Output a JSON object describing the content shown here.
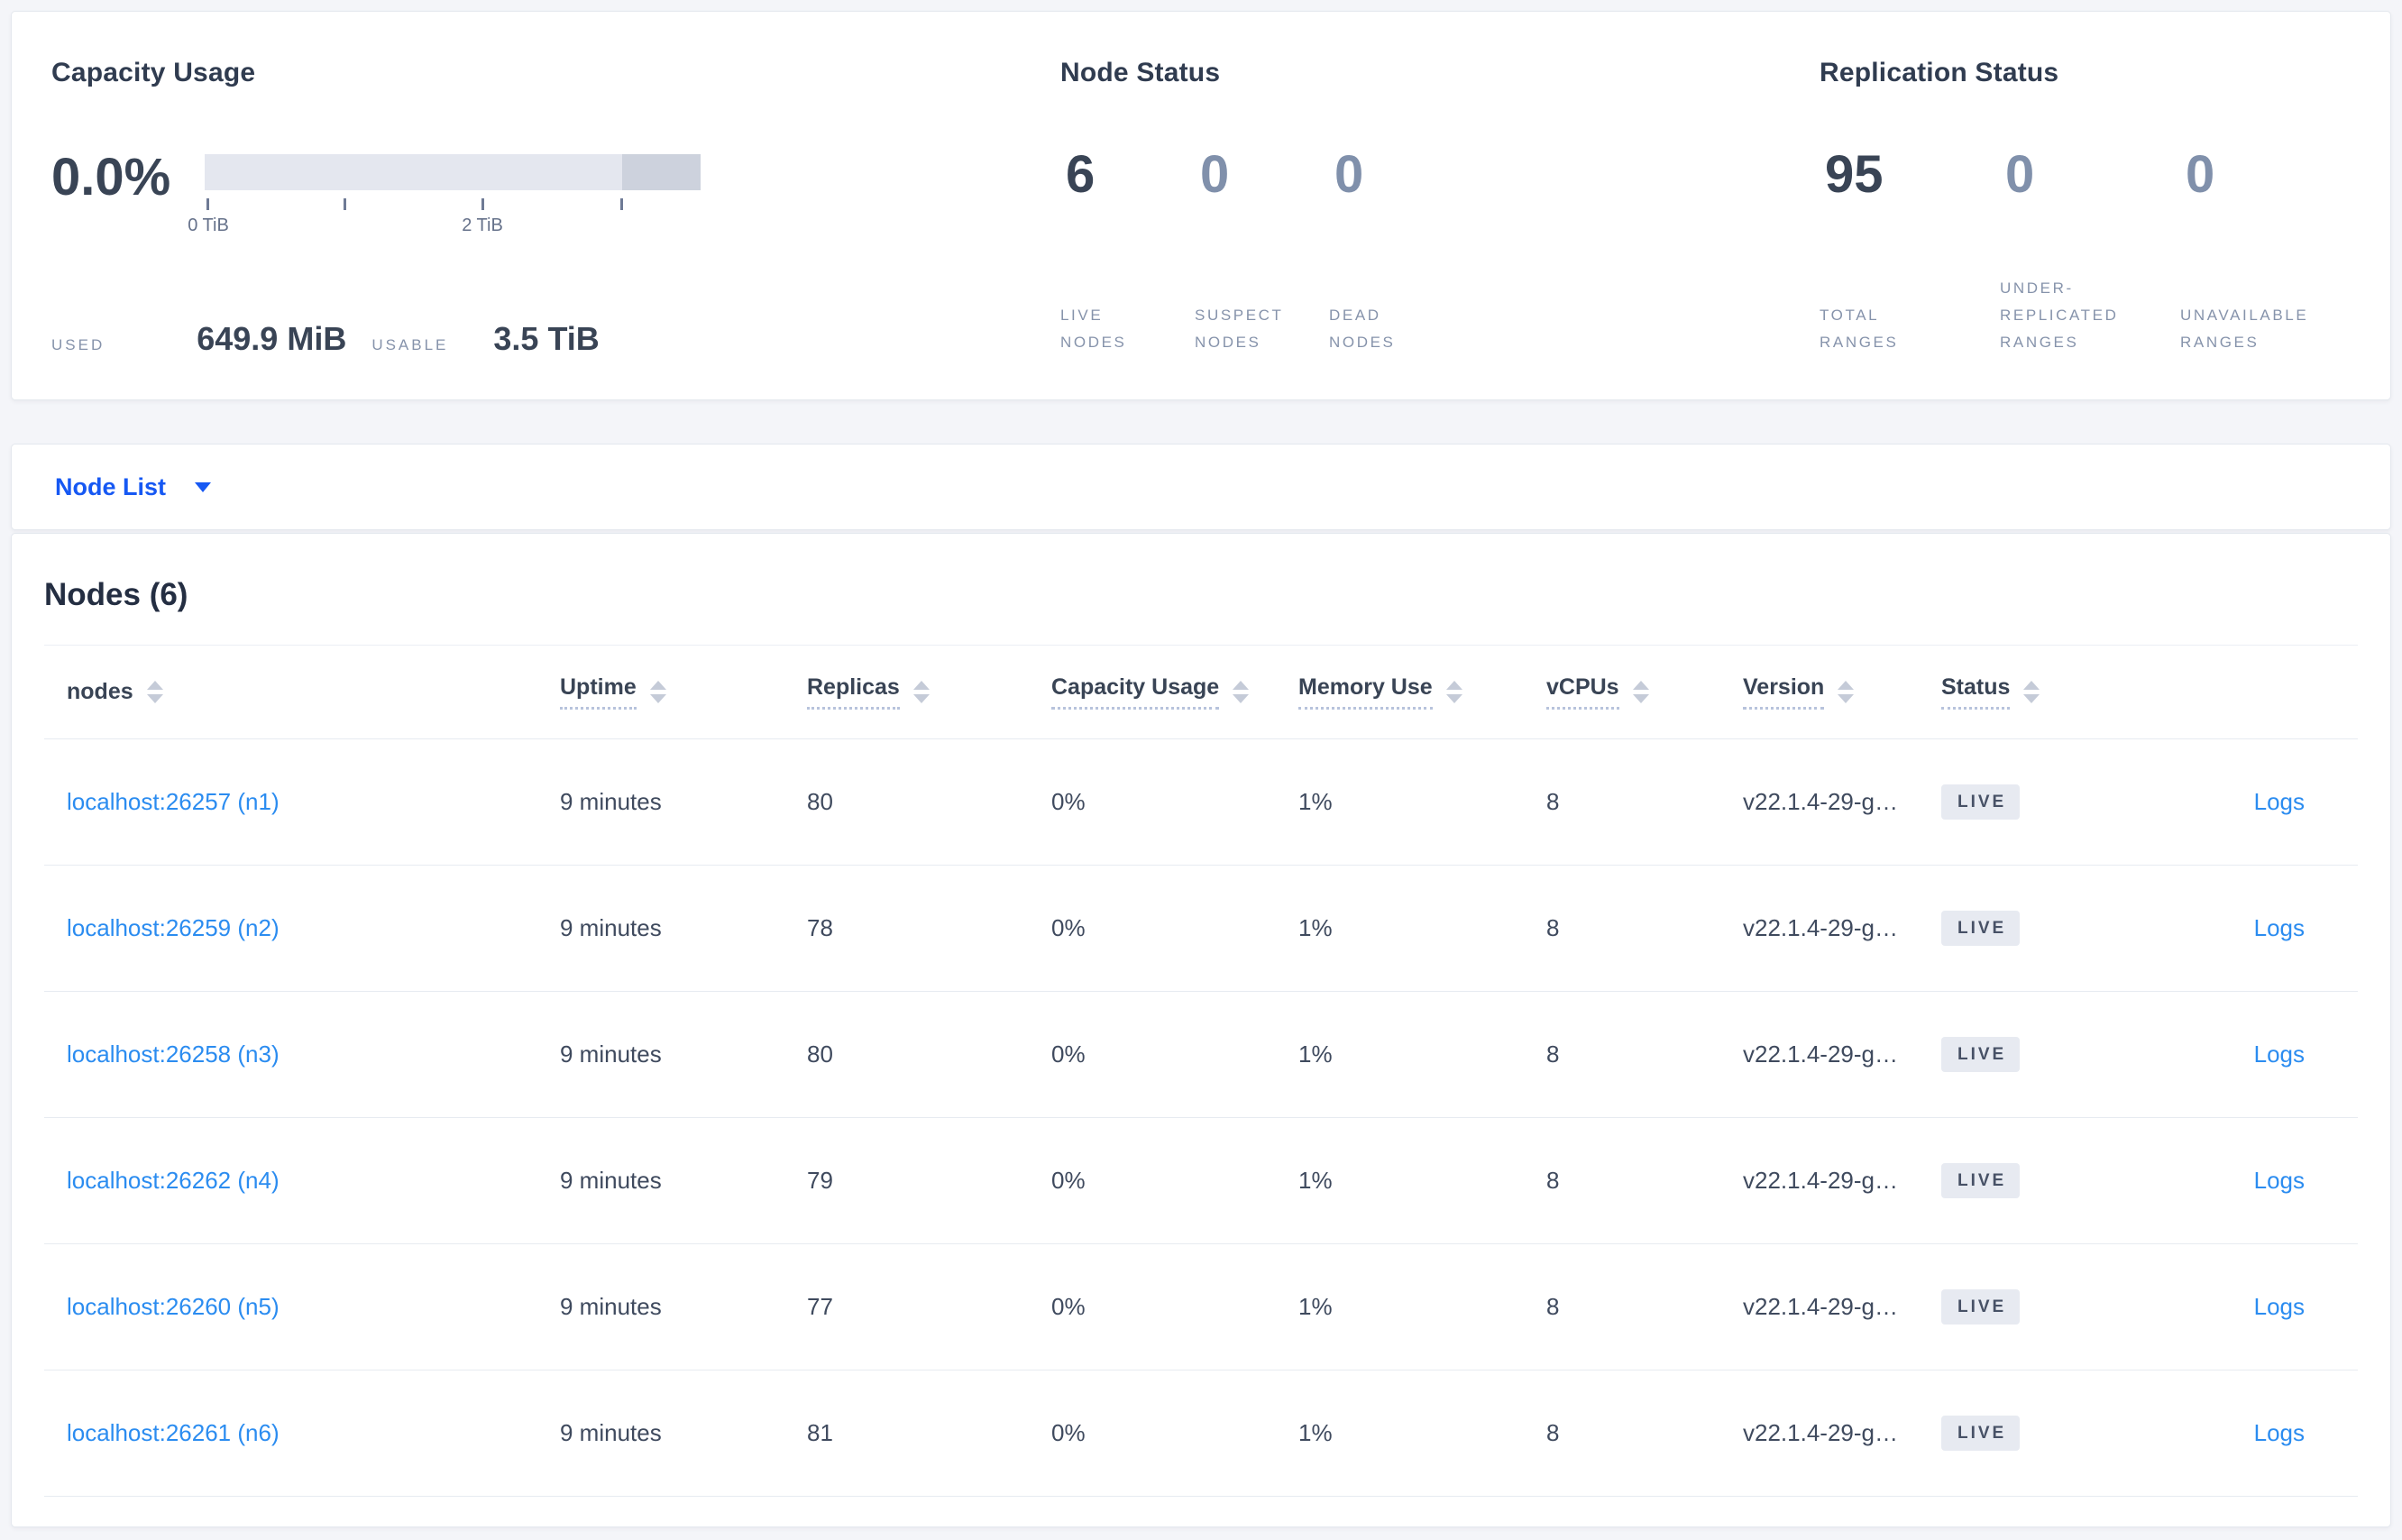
{
  "colors": {
    "page_background": "#f4f5f9",
    "accent_blue": "#1658f3",
    "link_blue": "#2b8cf0",
    "text_dark": "#394455",
    "text_muted": "#8693ab",
    "badge_background": "#e7eaf1",
    "bar_track": "#e4e7ef",
    "bar_reserved_segment": "#cdd2dd"
  },
  "capacity": {
    "title": "Capacity Usage",
    "percent": "0.0%",
    "axis_ticks": [
      {
        "label": "0 TiB"
      },
      {
        "label": ""
      },
      {
        "label": "2 TiB"
      },
      {
        "label": ""
      }
    ],
    "used_label": "USED",
    "used_value": "649.9 MiB",
    "usable_label": "USABLE",
    "usable_value": "3.5 TiB"
  },
  "node_status": {
    "title": "Node Status",
    "stats": [
      {
        "value": "6",
        "label": "LIVE NODES",
        "muted": false
      },
      {
        "value": "0",
        "label": "SUSPECT NODES",
        "muted": true
      },
      {
        "value": "0",
        "label": "DEAD NODES",
        "muted": true
      }
    ]
  },
  "replication": {
    "title": "Replication Status",
    "stats": [
      {
        "value": "95",
        "label": "TOTAL RANGES",
        "muted": false
      },
      {
        "value": "0",
        "label": "UNDER-REPLICATED RANGES",
        "muted": true
      },
      {
        "value": "0",
        "label": "UNAVAILABLE RANGES",
        "muted": true
      }
    ]
  },
  "node_list": {
    "label": "Node List"
  },
  "nodes_table": {
    "heading": "Nodes (6)",
    "columns": [
      {
        "label": "nodes"
      },
      {
        "label": "Uptime"
      },
      {
        "label": "Replicas"
      },
      {
        "label": "Capacity Usage"
      },
      {
        "label": "Memory Use"
      },
      {
        "label": "vCPUs"
      },
      {
        "label": "Version"
      },
      {
        "label": "Status"
      }
    ],
    "rows": [
      {
        "host": "localhost:26257 (n1)",
        "uptime": "9 minutes",
        "replicas": "80",
        "capacity": "0%",
        "memory": "1%",
        "vcpus": "8",
        "version": "v22.1.4-29-g…",
        "status": "LIVE",
        "logs": "Logs"
      },
      {
        "host": "localhost:26259 (n2)",
        "uptime": "9 minutes",
        "replicas": "78",
        "capacity": "0%",
        "memory": "1%",
        "vcpus": "8",
        "version": "v22.1.4-29-g…",
        "status": "LIVE",
        "logs": "Logs"
      },
      {
        "host": "localhost:26258 (n3)",
        "uptime": "9 minutes",
        "replicas": "80",
        "capacity": "0%",
        "memory": "1%",
        "vcpus": "8",
        "version": "v22.1.4-29-g…",
        "status": "LIVE",
        "logs": "Logs"
      },
      {
        "host": "localhost:26262 (n4)",
        "uptime": "9 minutes",
        "replicas": "79",
        "capacity": "0%",
        "memory": "1%",
        "vcpus": "8",
        "version": "v22.1.4-29-g…",
        "status": "LIVE",
        "logs": "Logs"
      },
      {
        "host": "localhost:26260 (n5)",
        "uptime": "9 minutes",
        "replicas": "77",
        "capacity": "0%",
        "memory": "1%",
        "vcpus": "8",
        "version": "v22.1.4-29-g…",
        "status": "LIVE",
        "logs": "Logs"
      },
      {
        "host": "localhost:26261 (n6)",
        "uptime": "9 minutes",
        "replicas": "81",
        "capacity": "0%",
        "memory": "1%",
        "vcpus": "8",
        "version": "v22.1.4-29-g…",
        "status": "LIVE",
        "logs": "Logs"
      }
    ]
  }
}
